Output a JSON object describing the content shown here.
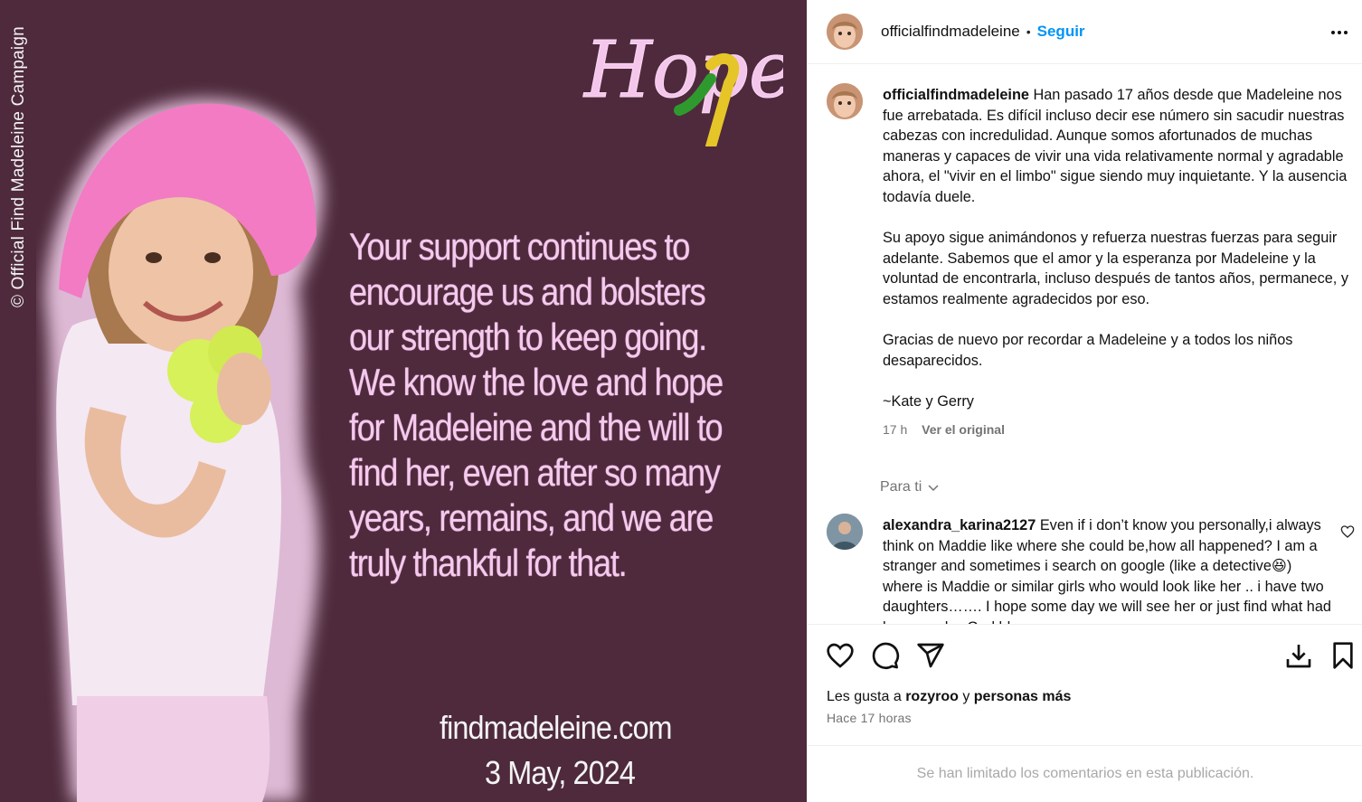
{
  "image": {
    "copyright": "© Official Find Madeleine Campaign",
    "logo_text": "Hope",
    "message": "Your support continues to encourage us and bolsters our strength to keep going. We know the love and hope for Madeleine and the will to find her, even after so many years, remains, and we are truly thankful for that.",
    "website": "findmadeleine.com",
    "date": "3 May, 2024"
  },
  "header": {
    "username": "officialfindmadeleine",
    "separator": "•",
    "follow_label": "Seguir"
  },
  "caption": {
    "username": "officialfindmadeleine",
    "paragraphs": [
      "Han pasado 17 años desde que Madeleine nos fue arrebatada. Es difícil incluso decir ese número sin sacudir nuestras cabezas con incredulidad. Aunque somos afortunados de muchas maneras y capaces de vivir una vida relativamente normal y agradable ahora, el \"vivir en el limbo\" sigue siendo muy inquietante. Y la ausencia todavía duele.",
      "Su apoyo sigue animándonos y refuerza nuestras fuerzas para seguir adelante. Sabemos que el amor y la esperanza por Madeleine y la voluntad de encontrarla, incluso después de tantos años, permanece, y estamos realmente agradecidos por eso.",
      "Gracias de nuevo por recordar a Madeleine y a todos los niños desaparecidos.",
      "~Kate y Gerry"
    ],
    "time": "17 h",
    "see_original": "Ver el original"
  },
  "for_you_label": "Para ti",
  "comment": {
    "username": "alexandra_karina2127",
    "text": "Even if i don’t know you personally,i always think on Maddie like where she could be,how all happened? I am a stranger and sometimes i search on google (like a detective😆) where is Maddie or similar girls who would look like her .. i have two daughters……. I hope some day we will see her or just find what had happened….God bless"
  },
  "likes": {
    "prefix": "Les gusta a",
    "user": "rozyroo",
    "joiner": "y",
    "others": "personas más"
  },
  "time_ago": "Hace 17 horas",
  "comments_limited": "Se han limitado los comentarios en esta publicación.",
  "colors": {
    "panel_bg": "#4e2a3c",
    "message_pink": "#f6c9ee",
    "follow_blue": "#0095f6",
    "muted_gray": "#737373"
  }
}
